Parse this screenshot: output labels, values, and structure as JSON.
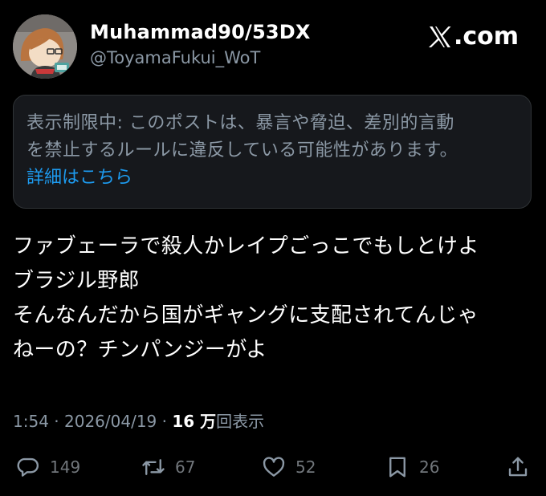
{
  "author": {
    "display_name": "Muhammad90/53DX",
    "handle": "@ToyamaFukui_WoT",
    "avatar_icon": "cartoon-avatar-icon"
  },
  "brand": {
    "logo_icon": "x-logo-icon",
    "text": ".com"
  },
  "notice": {
    "line1": "表示制限中: このポストは、暴言や脅迫、差別的言動",
    "line2": "を禁止するルールに違反している可能性があります。",
    "link": "詳細はこちら"
  },
  "tweet": {
    "lines": [
      "ファブェーラで殺人かレイプごっこでもしとけよ",
      "ブラジル野郎",
      "そんなんだから国がギャングに支配されてんじゃ",
      "ねーの？チンパンジーがよ"
    ]
  },
  "meta": {
    "time": "1:54",
    "sep1": " · ",
    "date": "2026/04/19",
    "sep2": " · ",
    "views": "16 万",
    "views_label": "回表示"
  },
  "actions": {
    "reply": {
      "icon": "reply-icon",
      "count": "149"
    },
    "repost": {
      "icon": "repost-icon",
      "count": "67"
    },
    "like": {
      "icon": "like-icon",
      "count": "52"
    },
    "bookmark": {
      "icon": "bookmark-icon",
      "count": "26"
    },
    "share": {
      "icon": "share-icon"
    }
  },
  "colors": {
    "background": "#000000",
    "text": "#ffffff",
    "secondary": "#8b98a5",
    "link": "#1d9bf0",
    "notice_bg": "#16181c"
  }
}
